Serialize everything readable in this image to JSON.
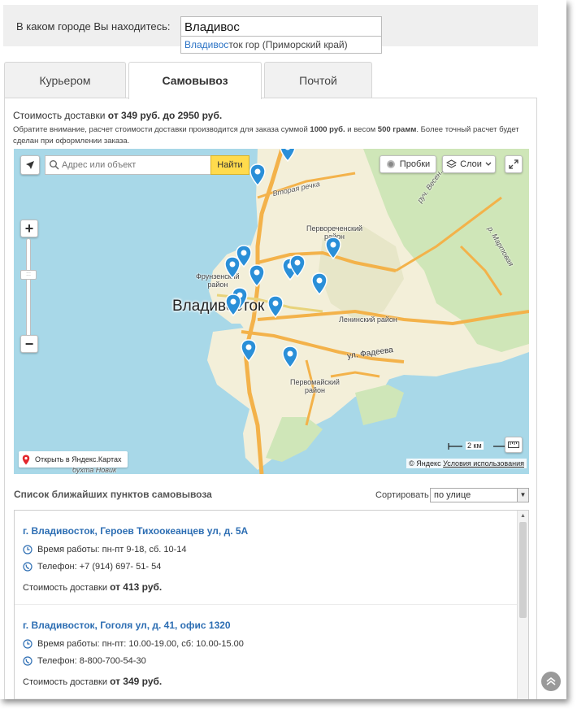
{
  "city_bar": {
    "label": "В каком городе Вы находитесь:",
    "input_value": "Владивос",
    "suggestion_match": "Владивос",
    "suggestion_rest": "ток гор (Приморский край)"
  },
  "tabs": [
    {
      "label": "Курьером",
      "active": false
    },
    {
      "label": "Самовывоз",
      "active": true
    },
    {
      "label": "Почтой",
      "active": false
    }
  ],
  "delivery": {
    "cost_prefix": "Стоимость доставки",
    "cost_range": "от 349 руб. до 2950 руб.",
    "note_1": "Обратите внимание, расчет стоимости доставки производится для заказа суммой",
    "note_sum": "1000 руб.",
    "note_2": "и весом",
    "note_weight": "500 грамм",
    "note_3": ". Более точный расчет будет сделан при оформлении заказа."
  },
  "map": {
    "search_placeholder": "Адрес или объект",
    "find_label": "Найти",
    "traffic_label": "Пробки",
    "layers_label": "Слои",
    "zoom_in": "+",
    "zoom_out": "−",
    "city_label": "Владивосток",
    "districts": {
      "frunzensky": "Фрунзенский\nрайон",
      "pervorechensky": "Первореченский\nрайон",
      "leninsky": "Ленинский район",
      "pervomaisky": "Первомайский\nрайон"
    },
    "streets": {
      "fadeeva": "ул. Фадеева",
      "vtoraya_rechka": "Вторая речка",
      "rucheek": "руч. Весен..",
      "martovaya": "р. Мартовая",
      "bukhta": "бухта Новик"
    },
    "scale_label": "2 км",
    "open_label": "Открыть в Яндекс.Картах",
    "copyright": "© Яндекс",
    "terms": "Условия использования",
    "colors": {
      "water": "#a8d8e8",
      "land": "#f3efd9",
      "green": "#cfe6b8",
      "road": "#f3b24a",
      "pin": "#2a8fd8"
    }
  },
  "list": {
    "title": "Список ближайших пунктов самовывоза",
    "sort_label": "Сортировать",
    "sort_value": "по улице",
    "items": [
      {
        "title": "г. Владивосток, Героев Тихоокеанцев ул, д. 5А",
        "hours": "Время работы: пн-пт 9-18, сб. 10-14",
        "phone": "Телефон: +7 (914) 697- 51- 54",
        "cost_prefix": "Стоимость доставки",
        "cost": "от 413 руб."
      },
      {
        "title": "г. Владивосток, Гоголя ул, д. 41, офис 1320",
        "hours": "Время работы: пн-пт: 10.00-19.00, сб: 10.00-15.00",
        "phone": "Телефон: 8-800-700-54-30",
        "cost_prefix": "Стоимость доставки",
        "cost": "от 349 руб."
      }
    ]
  }
}
